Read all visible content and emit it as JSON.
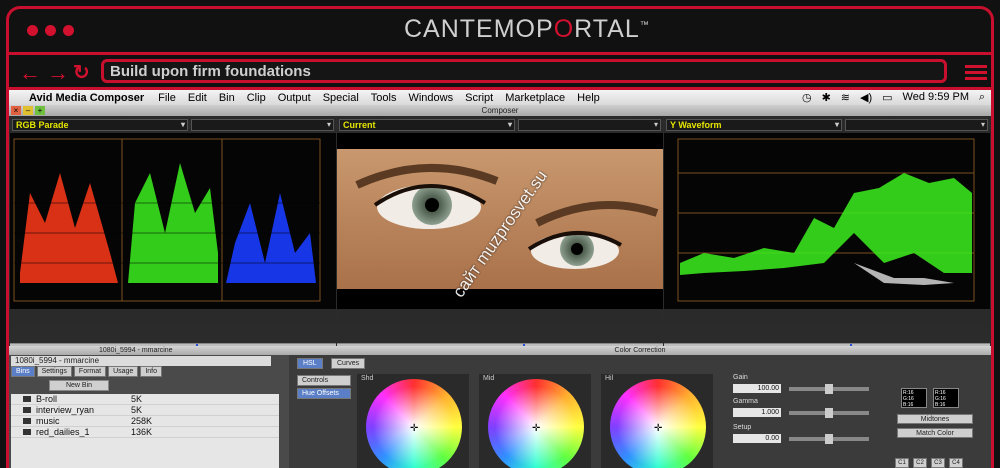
{
  "brand": {
    "pre": "CANTEMO",
    "o": "P",
    "mid": "O",
    "post": "RTAL",
    "tm": "™"
  },
  "browser": {
    "url_text": "Build upon firm foundations"
  },
  "menubar": {
    "app": "Avid Media Composer",
    "items": [
      "File",
      "Edit",
      "Bin",
      "Clip",
      "Output",
      "Special",
      "Tools",
      "Windows",
      "Script",
      "Marketplace",
      "Help"
    ],
    "clock": "Wed 9:59 PM"
  },
  "window": {
    "title": "Composer"
  },
  "panels": [
    {
      "label": "RGB Parade"
    },
    {
      "label": "Current"
    },
    {
      "label": "Y Waveform"
    }
  ],
  "bin": {
    "header": "1080i_5994 - mmarcine",
    "name": "1080i_5994 - mmarcine",
    "tabs": [
      "Bins",
      "Settings",
      "Format",
      "Usage",
      "Info"
    ],
    "new_bin": "New Bin",
    "rows": [
      {
        "name": "B-roll",
        "size": "5K"
      },
      {
        "name": "interview_ryan",
        "size": "5K"
      },
      {
        "name": "music",
        "size": "258K"
      },
      {
        "name": "red_dailies_1",
        "size": "136K"
      }
    ]
  },
  "color_correction": {
    "title": "Color Correction",
    "tabs": [
      "HSL",
      "Curves"
    ],
    "side": [
      "Controls",
      "Hue Offsets"
    ],
    "wheels": [
      "Shd",
      "Mid",
      "Hil"
    ],
    "params": [
      {
        "label": "Gain",
        "value": "100.00"
      },
      {
        "label": "Gamma",
        "value": "1.000"
      },
      {
        "label": "Setup",
        "value": "0.00"
      }
    ],
    "swatch_left": "R:16 G:16 B:16",
    "swatch_right": "R:16 G:16 B:16",
    "midtones": "Midtones",
    "match_color": "Match Color",
    "channels": [
      "C1",
      "C2",
      "C3",
      "C4"
    ]
  },
  "watermark": "сайт muzprosvet.su",
  "colors": {
    "accent": "#d2112f",
    "scope_green": "#3cf01e",
    "scope_red": "#ff3a1a",
    "scope_blue": "#1a3cff"
  }
}
